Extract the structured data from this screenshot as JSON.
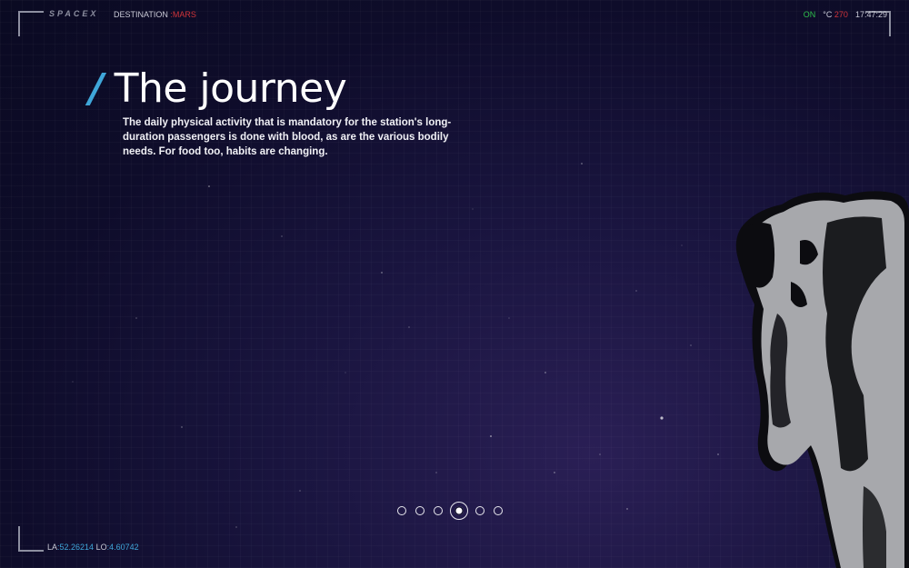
{
  "header": {
    "logo": "SPACEX",
    "destination_label": "DESTINATION",
    "destination_value": ":MARS",
    "status_on": "ON",
    "temp_unit": "°C",
    "temp_value": "270",
    "clock": "17:47:29"
  },
  "main": {
    "title": "The journey",
    "title_slash": "/",
    "body": "The daily physical activity that is mandatory for the station's long-duration passengers is done with blood, as are the various bodily needs. For food too, habits are changing."
  },
  "pagination": {
    "count": 6,
    "active_index": 3
  },
  "footer": {
    "la_label": "LA",
    "la_value": ":52.26214",
    "lo_label": "LO",
    "lo_value": ":4.60742"
  },
  "colors": {
    "accent_blue": "#3fa6d9",
    "accent_red": "#d0343a",
    "status_green": "#2fbf4c"
  },
  "icons": [
    "astronaut-illustration"
  ]
}
